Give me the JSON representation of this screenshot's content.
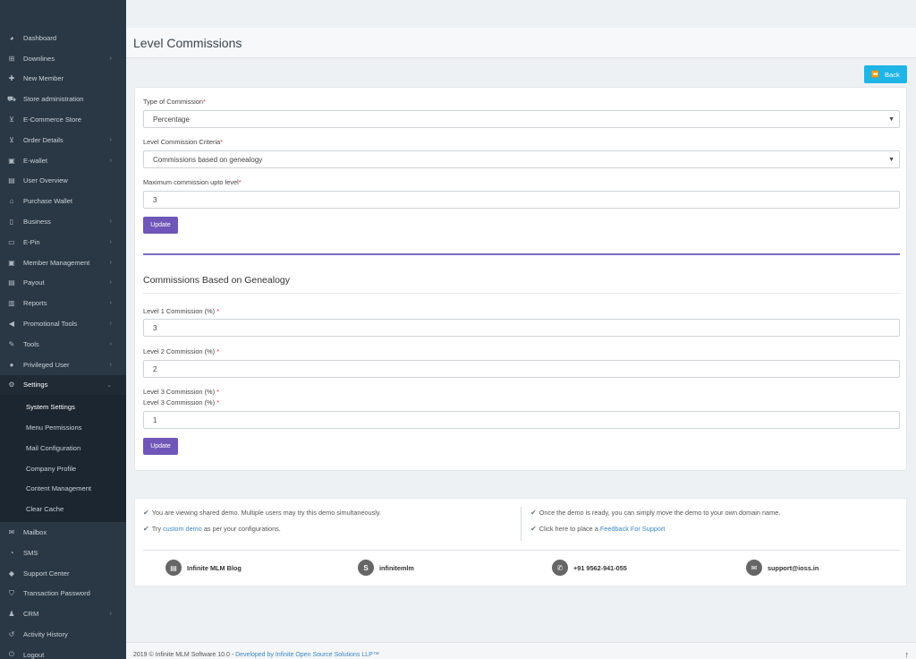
{
  "sidebar": {
    "items": [
      {
        "label": "Dashboard",
        "icon": "dashboard-icon",
        "glyph": "◕",
        "chevron": false
      },
      {
        "label": "Downlines",
        "icon": "sitemap-icon",
        "glyph": "⊞",
        "chevron": true
      },
      {
        "label": "New Member",
        "icon": "user-plus-icon",
        "glyph": "✚",
        "chevron": false
      },
      {
        "label": "Store administration",
        "icon": "store-icon",
        "glyph": "⛟",
        "chevron": false
      },
      {
        "label": "E-Commerce Store",
        "icon": "cart-icon",
        "glyph": "⊻",
        "chevron": false
      },
      {
        "label": "Order Details",
        "icon": "cart-icon",
        "glyph": "⊻",
        "chevron": true
      },
      {
        "label": "E-wallet",
        "icon": "wallet-icon",
        "glyph": "▣",
        "chevron": true
      },
      {
        "label": "User Overview",
        "icon": "id-card-icon",
        "glyph": "▤",
        "chevron": false
      },
      {
        "label": "Purchase Wallet",
        "icon": "bank-icon",
        "glyph": "⌂",
        "chevron": false
      },
      {
        "label": "Business",
        "icon": "file-icon",
        "glyph": "▯",
        "chevron": true
      },
      {
        "label": "E-Pin",
        "icon": "bookmark-icon",
        "glyph": "▭",
        "chevron": true
      },
      {
        "label": "Member Management",
        "icon": "member-card-icon",
        "glyph": "▣",
        "chevron": true
      },
      {
        "label": "Payout",
        "icon": "money-icon",
        "glyph": "▤",
        "chevron": true
      },
      {
        "label": "Reports",
        "icon": "chart-icon",
        "glyph": "▥",
        "chevron": true
      },
      {
        "label": "Promotional Tools",
        "icon": "bullhorn-icon",
        "glyph": "◀",
        "chevron": true
      },
      {
        "label": "Tools",
        "icon": "wrench-icon",
        "glyph": "✎",
        "chevron": true
      },
      {
        "label": "Privileged User",
        "icon": "user-circle-icon",
        "glyph": "●",
        "chevron": true
      }
    ],
    "settings": {
      "label": "Settings",
      "icon": "cogs-icon",
      "glyph": "⚙",
      "chevron": "⌄"
    },
    "submenu": [
      {
        "label": "System Settings",
        "current": true
      },
      {
        "label": "Menu Permissions",
        "current": false
      },
      {
        "label": "Mail Configuration",
        "current": false
      },
      {
        "label": "Company Profile",
        "current": false
      },
      {
        "label": "Content Management",
        "current": false
      },
      {
        "label": "Clear Cache",
        "current": false
      }
    ],
    "bottom_items": [
      {
        "label": "Mailbox",
        "icon": "envelope-icon",
        "glyph": "✉",
        "chevron": false
      },
      {
        "label": "SMS",
        "icon": "sms-icon",
        "glyph": "◔",
        "chevron": false
      },
      {
        "label": "Support Center",
        "icon": "support-icon",
        "glyph": "◆",
        "chevron": false
      },
      {
        "label": "Transaction Password",
        "icon": "shield-icon",
        "glyph": "⛉",
        "chevron": false
      },
      {
        "label": "CRM",
        "icon": "users-icon",
        "glyph": "♟",
        "chevron": true
      },
      {
        "label": "Activity History",
        "icon": "history-icon",
        "glyph": "↺",
        "chevron": false
      },
      {
        "label": "Logout",
        "icon": "logout-icon",
        "glyph": "⏻",
        "chevron": false
      }
    ]
  },
  "header": {
    "title": "Level Commissions",
    "back_label": "Back",
    "back_icon": "⏪"
  },
  "form": {
    "type_label": "Type of Commission",
    "type_value": "Percentage",
    "criteria_label": "Level Commission Criteria",
    "criteria_value": "Commissions based on genealogy",
    "max_label": "Maximum commission upto level",
    "max_value": "3",
    "update_label": "Update",
    "required_mark": "*",
    "caret": "▼"
  },
  "genealogy": {
    "title": "Commissions Based on Genealogy",
    "levels": [
      {
        "label": "Level 1 Commission (%) ",
        "value": "3"
      },
      {
        "label": "Level 2 Commission (%) ",
        "value": "2"
      },
      {
        "label": "Level 3 Commission (%) ",
        "value": "1"
      }
    ],
    "duplicate_label": "Level 3 Commission (%) ",
    "update_label": "Update"
  },
  "info": {
    "check": "✔",
    "shared_demo": "You are viewing shared demo. Multiple users may try this demo simultaneously.",
    "try_prefix": "Try ",
    "custom_demo": "custom demo",
    "try_suffix": " as per your configurations.",
    "ready_text": "Once the demo is ready, you can simply move the demo to your own domain name.",
    "feedback_prefix": "Click here to place a ",
    "feedback_link": "Feedback For Support",
    "contacts": [
      {
        "label": "Infinite MLM Blog",
        "icon": "newspaper-icon",
        "glyph": "▤"
      },
      {
        "label": "infinitemlm",
        "icon": "skype-icon",
        "glyph": "S"
      },
      {
        "label": "+91 9562-941-055",
        "icon": "whatsapp-icon",
        "glyph": "✆"
      },
      {
        "label": "support@ioss.in",
        "icon": "mail-icon",
        "glyph": "✉"
      }
    ]
  },
  "footer": {
    "copyright": "2019 © Infinite MLM Software 10.0 - ",
    "developer": "Developed by Infinite Open Source Solutions LLP™",
    "up_arrow": "↑"
  }
}
